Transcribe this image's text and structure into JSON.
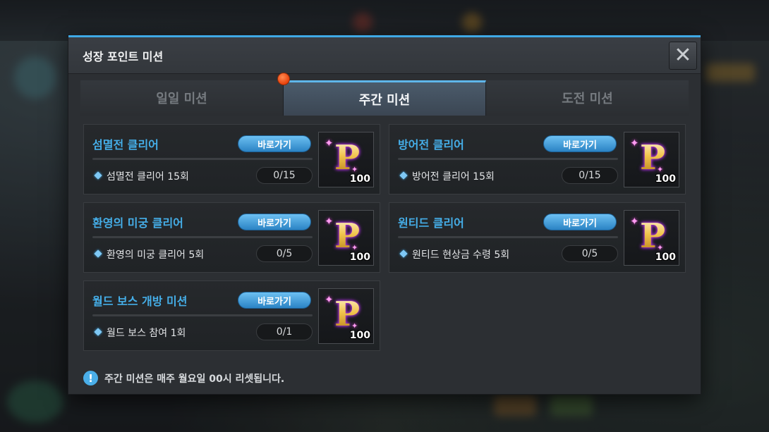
{
  "modal": {
    "title": "성장 포인트 미션",
    "close_icon": "close-x-icon"
  },
  "tabs": [
    {
      "label": "일일 미션",
      "active": false
    },
    {
      "label": "주간 미션",
      "active": true
    },
    {
      "label": "도전 미션",
      "active": false
    }
  ],
  "missions": [
    {
      "title": "섬멸전 클리어",
      "button": "바로가기",
      "desc": "섬멸전 클리어 15회",
      "progress": "0/15",
      "reward_icon": "growth-point-p-icon",
      "reward_count": "100"
    },
    {
      "title": "방어전 클리어",
      "button": "바로가기",
      "desc": "방어전 클리어 15회",
      "progress": "0/15",
      "reward_icon": "growth-point-p-icon",
      "reward_count": "100"
    },
    {
      "title": "환영의 미궁 클리어",
      "button": "바로가기",
      "desc": "환영의 미궁 클리어 5회",
      "progress": "0/5",
      "reward_icon": "growth-point-p-icon",
      "reward_count": "100"
    },
    {
      "title": "원티드 클리어",
      "button": "바로가기",
      "desc": "원티드 현상금 수령 5회",
      "progress": "0/5",
      "reward_icon": "growth-point-p-icon",
      "reward_count": "100"
    },
    {
      "title": "월드 보스 개방 미션",
      "button": "바로가기",
      "desc": "월드 보스 참여 1회",
      "progress": "0/1",
      "reward_icon": "growth-point-p-icon",
      "reward_count": "100"
    }
  ],
  "reward_letter": "P",
  "notice": {
    "icon": "exclamation-icon",
    "text": "주간 미션은 매주 월요일 00시 리셋됩니다."
  },
  "colors": {
    "accent": "#3fa9e6",
    "title_blue": "#45aee8",
    "notify_dot": "#e8420c"
  }
}
